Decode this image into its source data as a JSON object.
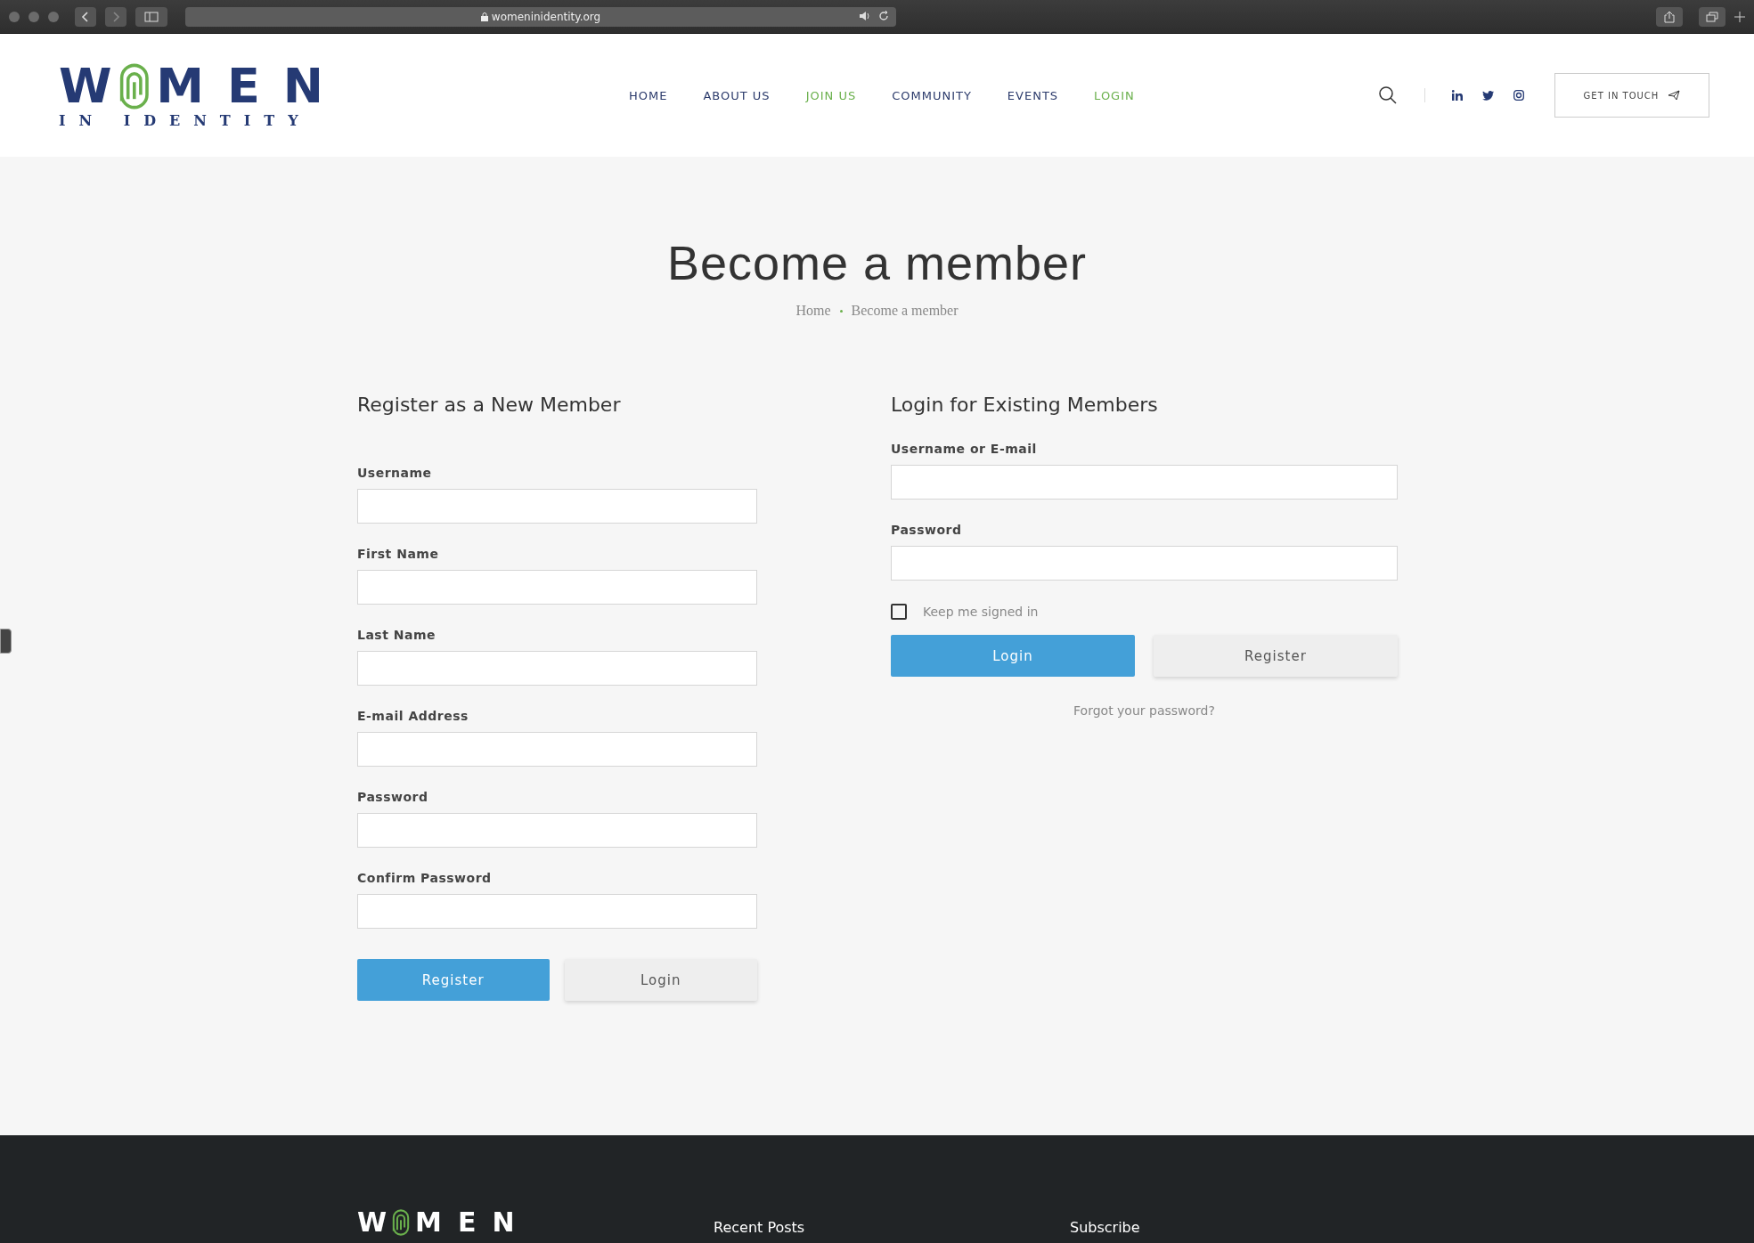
{
  "browser": {
    "url": "womeninidentity.org"
  },
  "header": {
    "logo": {
      "before": "W",
      "after": "MEN",
      "tagline": "IN IDENTITY"
    },
    "nav": [
      {
        "label": "HOME",
        "color": "#2b3a6b"
      },
      {
        "label": "ABOUT US",
        "color": "#2b3a6b"
      },
      {
        "label": "JOIN US",
        "color": "#6ab04c"
      },
      {
        "label": "COMMUNITY",
        "color": "#2b3a6b"
      },
      {
        "label": "EVENTS",
        "color": "#2b3a6b"
      },
      {
        "label": "LOGIN",
        "color": "#6ab04c"
      }
    ],
    "cta": "GET IN TOUCH"
  },
  "hero": {
    "title": "Become a member",
    "breadcrumb": [
      "Home",
      "Become a member"
    ]
  },
  "register": {
    "heading": "Register as a New Member",
    "fields": [
      {
        "label": "Username"
      },
      {
        "label": "First Name"
      },
      {
        "label": "Last Name"
      },
      {
        "label": "E-mail Address"
      },
      {
        "label": "Password"
      },
      {
        "label": "Confirm Password"
      }
    ],
    "buttons": [
      {
        "label": "Register",
        "kind": "primary"
      },
      {
        "label": "Login",
        "kind": "secondary"
      }
    ]
  },
  "login": {
    "heading": "Login for Existing Members",
    "fields": [
      {
        "label": "Username or E-mail"
      },
      {
        "label": "Password"
      }
    ],
    "remember": {
      "label": "Keep me signed in",
      "checked": false
    },
    "buttons": [
      {
        "label": "Login",
        "kind": "primary"
      },
      {
        "label": "Register",
        "kind": "secondary"
      }
    ],
    "forgot": "Forgot your password?"
  },
  "footer": {
    "logo": {
      "before": "W",
      "after": "MEN"
    },
    "columns": [
      "Recent Posts",
      "Subscribe"
    ]
  }
}
